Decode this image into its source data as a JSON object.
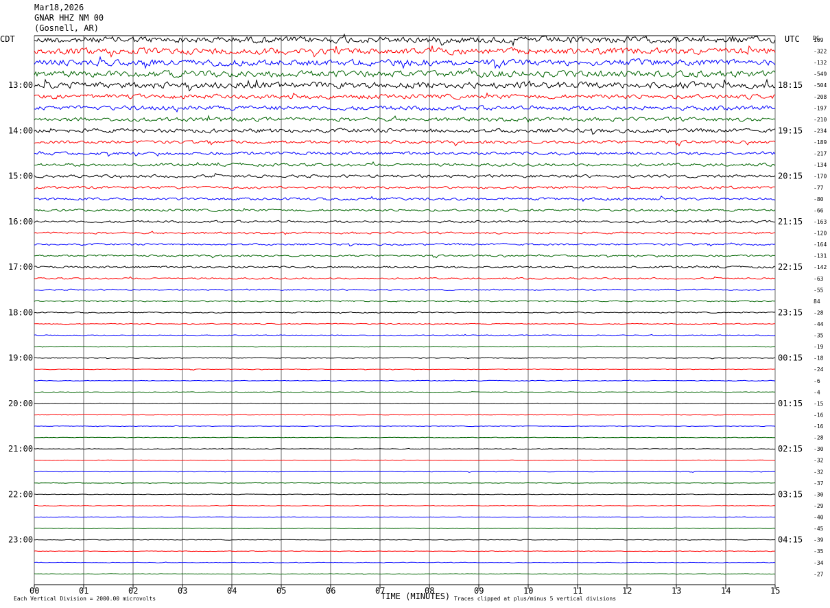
{
  "header": {
    "date": "Mar18,2026",
    "station": "GNAR HHZ NM 00",
    "location": "(Gosnell, AR)",
    "left_zone": "CDT",
    "right_zone": "UTC",
    "dc_label": "DC"
  },
  "footer": {
    "scale_note": "Each Vertical Division = 2000.00 microvolts",
    "xlabel": "TIME (MINUTES)",
    "clip_note": "Traces clipped at plus/minus 5 vertical divisions"
  },
  "colors": {
    "cycle": [
      "#000000",
      "#ff0000",
      "#0000ff",
      "#006400"
    ],
    "grid": "#000000"
  },
  "chart_data": {
    "type": "line",
    "title": "GNAR HHZ NM 00 (Gosnell, AR) Mar18,2026",
    "xlabel": "TIME (MINUTES)",
    "xlim": [
      0,
      15
    ],
    "x_ticks": [
      "00",
      "01",
      "02",
      "03",
      "04",
      "05",
      "06",
      "07",
      "08",
      "09",
      "10",
      "11",
      "12",
      "13",
      "14",
      "15"
    ],
    "rows_per_hour": 4,
    "minutes_per_row": 15,
    "n_rows": 48,
    "left_hour_labels": [
      "13:00",
      "14:00",
      "15:00",
      "16:00",
      "17:00",
      "18:00",
      "19:00",
      "20:00",
      "21:00",
      "22:00",
      "23:00"
    ],
    "right_hour_labels": [
      "18:15",
      "19:15",
      "20:15",
      "21:15",
      "22:15",
      "23:15",
      "00:15",
      "01:15",
      "02:15",
      "03:15",
      "04:15"
    ],
    "dc_offsets": [
      109,
      -322,
      -132,
      -549,
      -504,
      -208,
      -197,
      -210,
      -234,
      -189,
      -217,
      -134,
      -170,
      -77,
      -80,
      -66,
      -163,
      -120,
      -164,
      -131,
      -142,
      -63,
      -55,
      84,
      -28,
      -44,
      -35,
      -19,
      -18,
      -24,
      -6,
      -4,
      -15,
      -16,
      -16,
      -28,
      -30,
      -32,
      -32,
      -37,
      -30,
      -29,
      -40,
      -45,
      -39,
      -35,
      -34,
      -27
    ],
    "trace_amplitude": [
      1.0,
      1.0,
      1.0,
      1.0,
      1.0,
      0.7,
      0.7,
      0.6,
      0.65,
      0.5,
      0.5,
      0.45,
      0.45,
      0.4,
      0.4,
      0.35,
      0.35,
      0.3,
      0.3,
      0.28,
      0.3,
      0.25,
      0.22,
      0.22,
      0.16,
      0.14,
      0.14,
      0.13,
      0.12,
      0.1,
      0.1,
      0.09,
      0.1,
      0.09,
      0.09,
      0.09,
      0.09,
      0.09,
      0.09,
      0.09,
      0.09,
      0.09,
      0.09,
      0.09,
      0.09,
      0.09,
      0.09,
      0.09
    ],
    "grid": true
  }
}
